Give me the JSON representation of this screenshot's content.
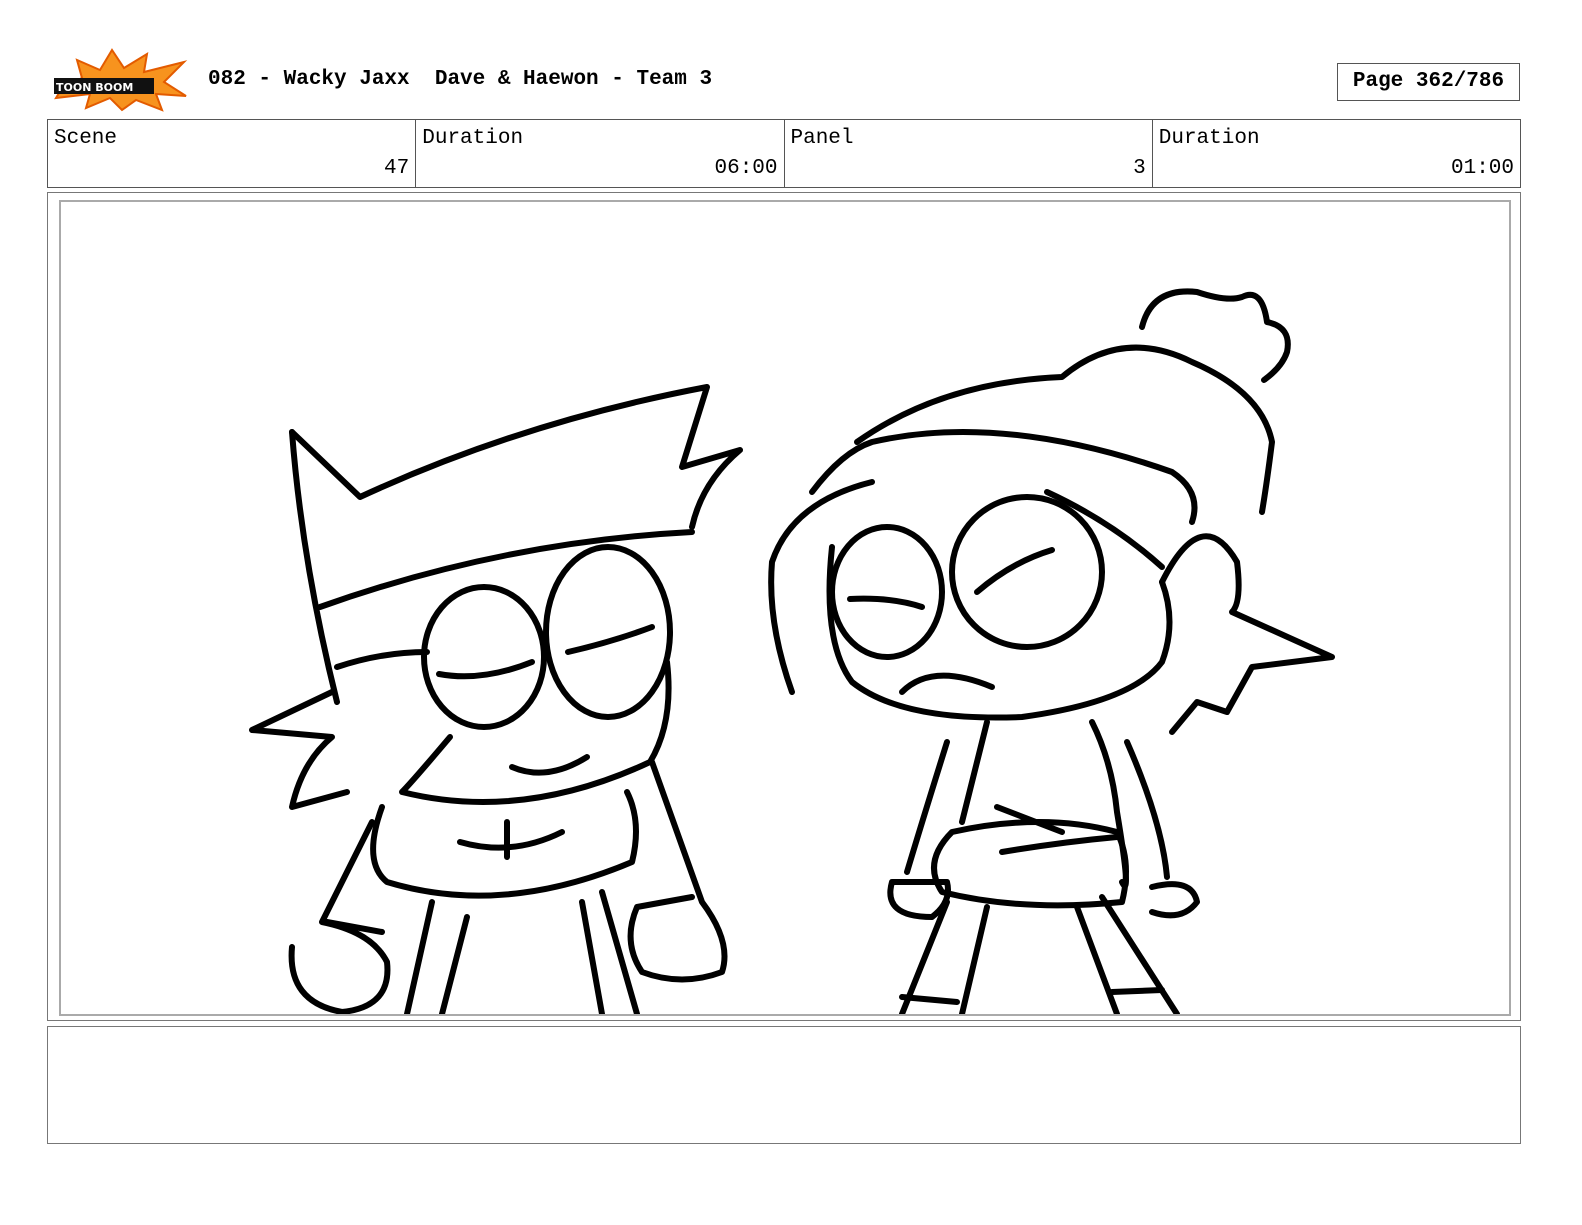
{
  "header": {
    "logo_text": "TOON BOOM",
    "title": "082 - Wacky Jaxx  Dave & Haewon - Team 3",
    "page": "Page 362/786"
  },
  "info": {
    "scene_label": "Scene",
    "scene_value": "47",
    "scene_duration_label": "Duration",
    "scene_duration_value": "06:00",
    "panel_label": "Panel",
    "panel_value": "3",
    "panel_duration_label": "Duration",
    "panel_duration_value": "01:00"
  },
  "notes": {}
}
